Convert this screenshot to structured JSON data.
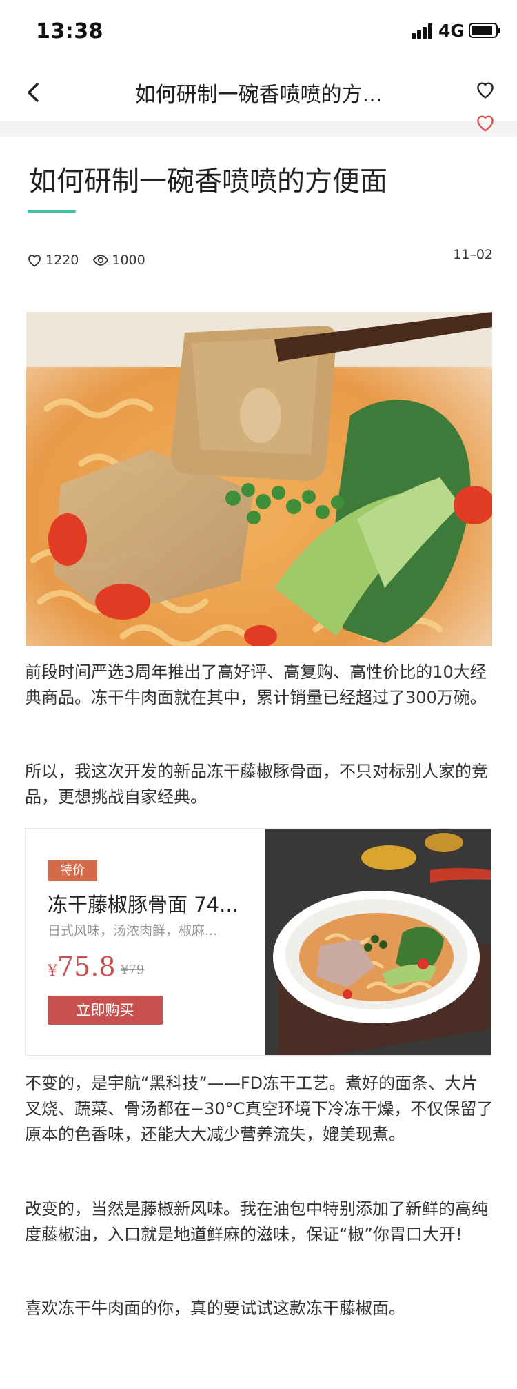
{
  "status_bar": {
    "time": "13:38",
    "network": "4G"
  },
  "nav": {
    "title": "如何研制一碗香喷喷的方...",
    "back_icon": "chevron-left-icon",
    "favorite_icon": "heart-outline-icon"
  },
  "article": {
    "title": "如何研制一碗香喷喷的方便面",
    "likes": "1220",
    "views": "1000",
    "date": "11–02",
    "accent_color": "#3cc2a4",
    "paragraphs": [
      "前段时间严选3周年推出了高好评、高复购、高性价比的10大经典商品。冻干牛肉面就在其中，累计销量已经超过了300万碗。",
      "所以，我这次开发的新品冻干藤椒豚骨面，不只对标别人家的竞品，更想挑战自家经典。",
      "不变的，是宇航“黑科技”——FD冻干工艺。煮好的面条、大片叉烧、蔬菜、骨汤都在−30°C真空环境下冷冻干燥，不仅保留了原本的色香味，还能大大减少营养流失，媲美现煮。",
      "改变的，当然是藤椒新风味。我在油包中特别添加了新鲜的高纯度藤椒油，入口就是地道鲜麻的滋味，保证“椒”你胃口大开!",
      "喜欢冻干牛肉面的你，真的要试试这款冻干藤椒面。"
    ]
  },
  "product": {
    "badge": "特价",
    "name": "冻干藤椒豚骨面 74...",
    "desc": "日式风味，汤浓肉鲜，椒麻...",
    "currency": "¥",
    "price": "75.8",
    "original_price": "¥79",
    "buy_label": "立即购买",
    "accent_color": "#c8504f"
  }
}
